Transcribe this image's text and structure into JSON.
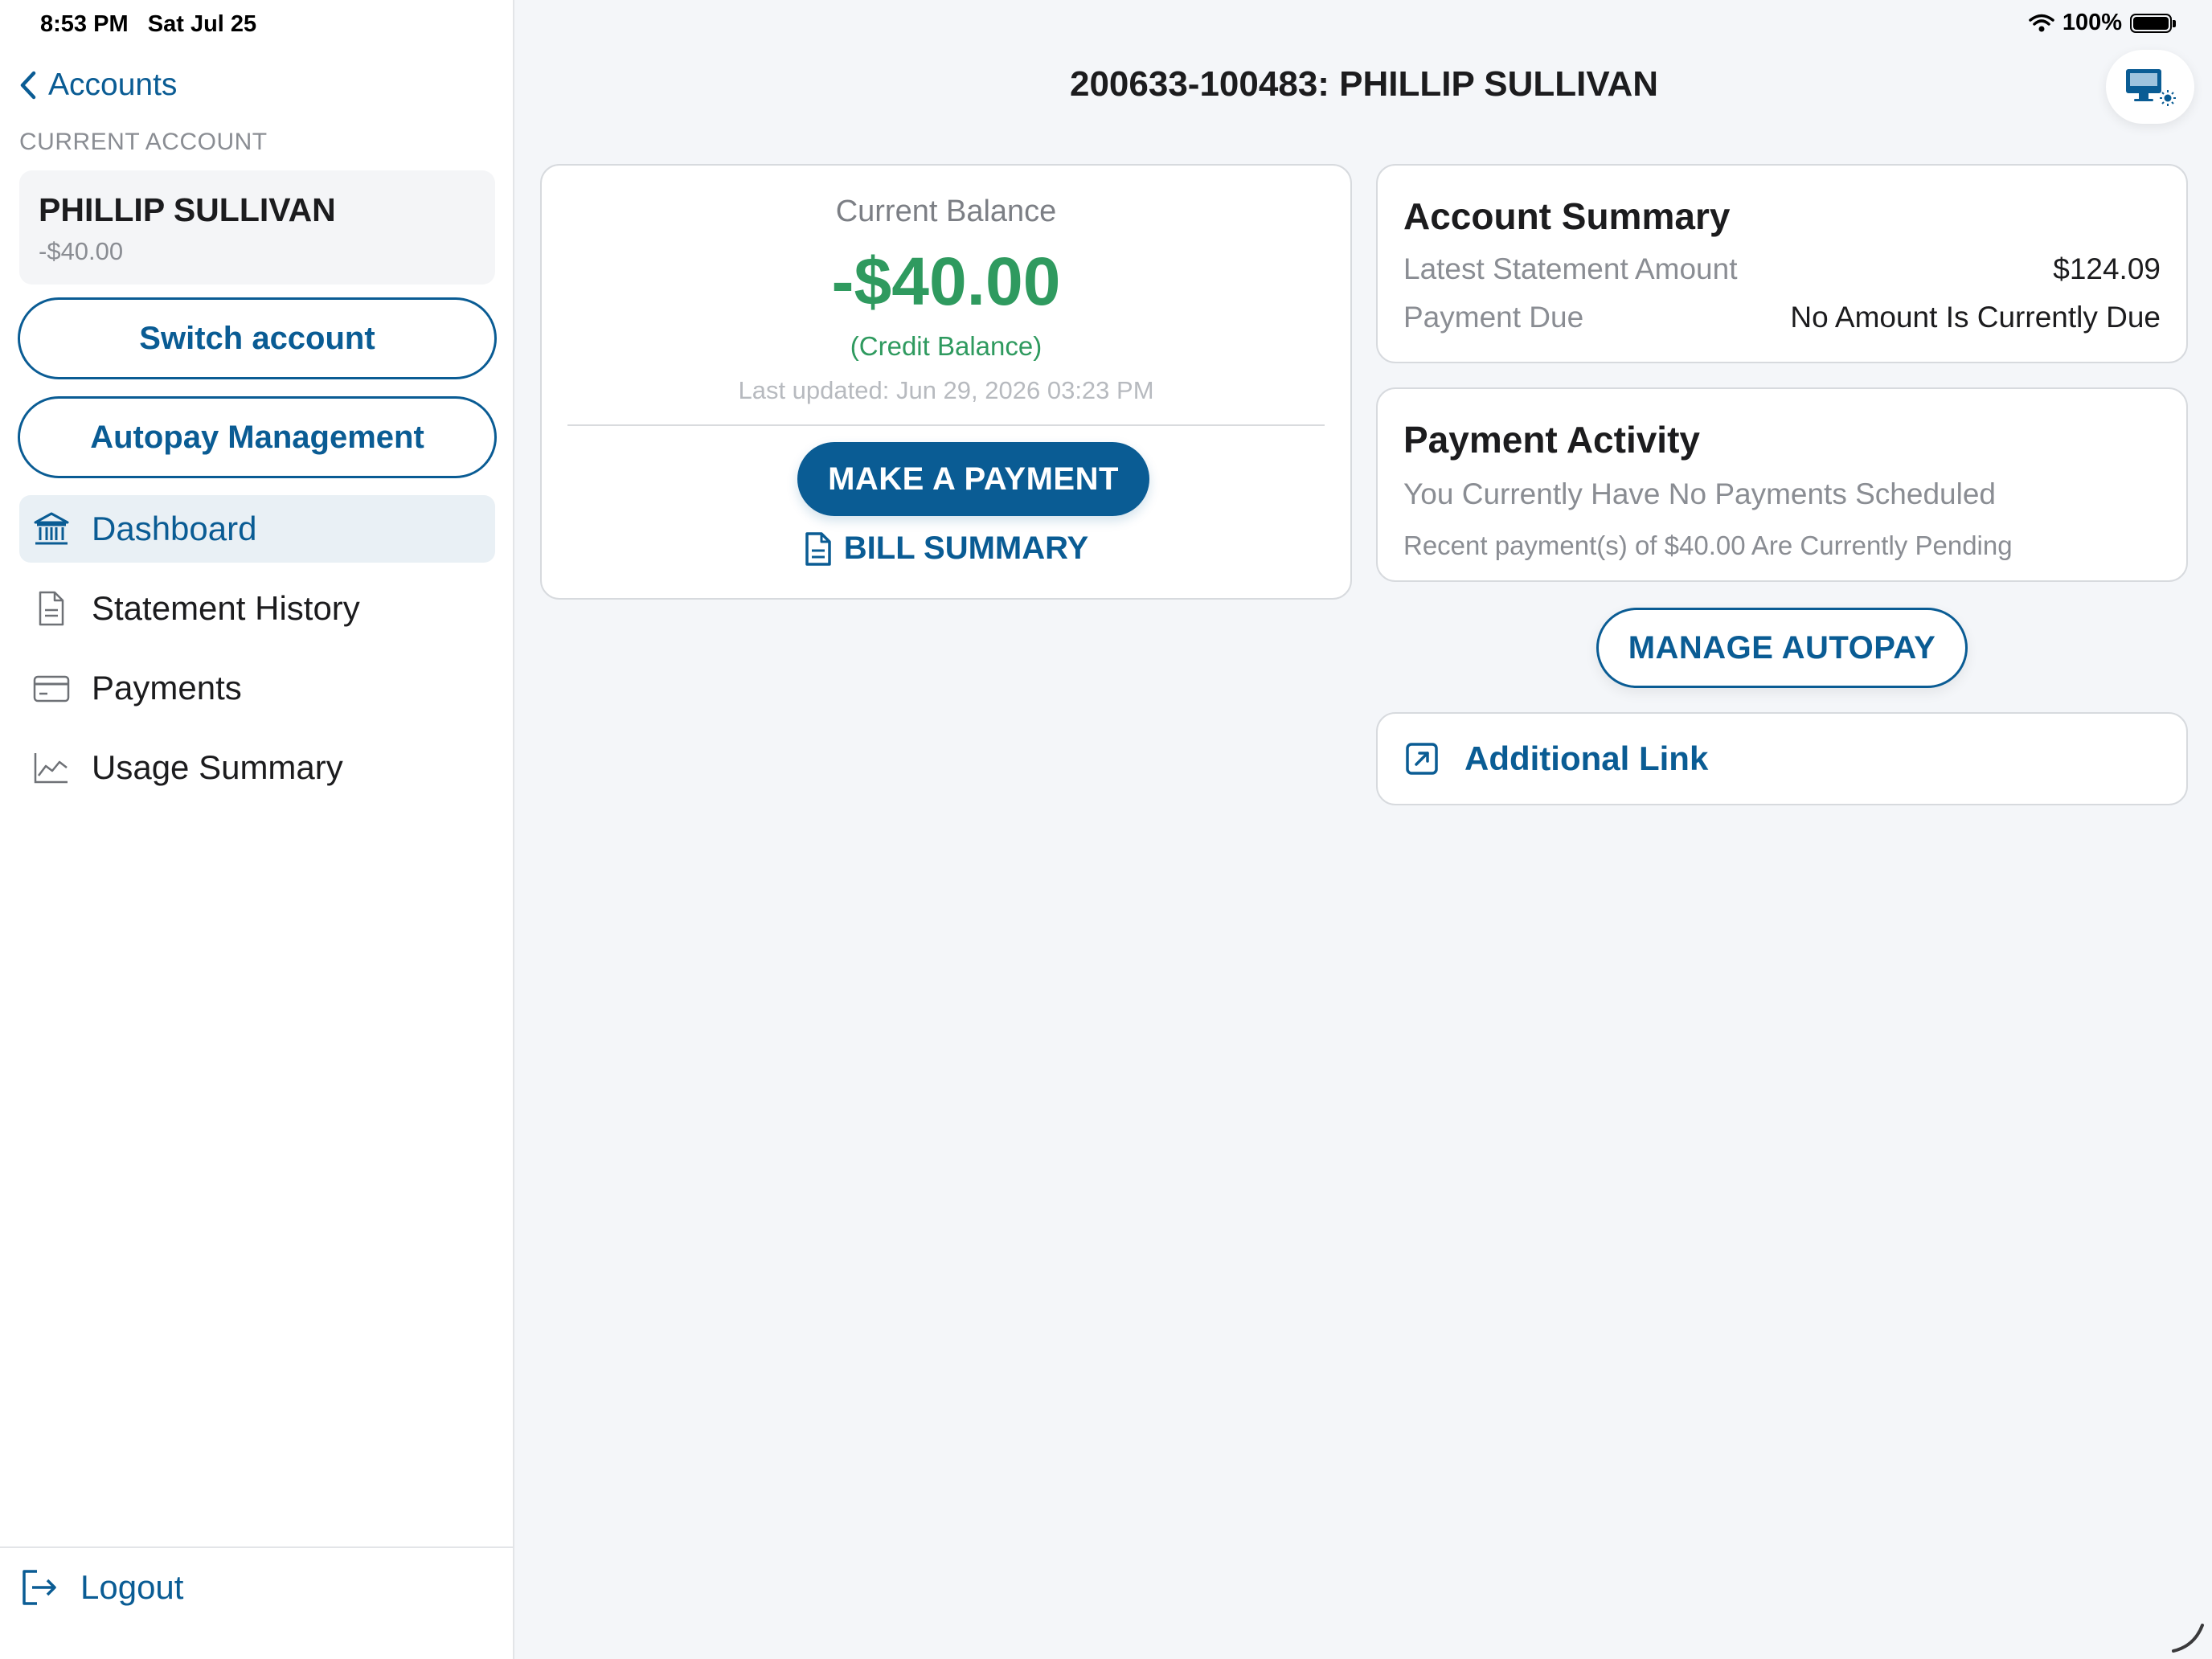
{
  "status_bar": {
    "time": "8:53 PM",
    "date": "Sat Jul 25",
    "battery": "100%"
  },
  "sidebar": {
    "back_label": "Accounts",
    "section_label": "CURRENT ACCOUNT",
    "account": {
      "name": "PHILLIP SULLIVAN",
      "balance": "-$40.00"
    },
    "switch_account": "Switch account",
    "autopay_management": "Autopay Management",
    "nav": [
      {
        "label": "Dashboard",
        "icon": "bank-icon",
        "active": true
      },
      {
        "label": "Statement History",
        "icon": "document-icon",
        "active": false
      },
      {
        "label": "Payments",
        "icon": "credit-card-icon",
        "active": false
      },
      {
        "label": "Usage Summary",
        "icon": "line-chart-icon",
        "active": false
      }
    ],
    "logout": "Logout"
  },
  "main": {
    "title": "200633-100483: PHILLIP SULLIVAN",
    "balance_card": {
      "label": "Current Balance",
      "amount": "-$40.00",
      "credit": "(Credit Balance)",
      "updated": "Last updated: Jun 29, 2026 03:23 PM",
      "pay_button": "MAKE A PAYMENT",
      "bill_summary": "BILL SUMMARY"
    },
    "account_summary": {
      "heading": "Account Summary",
      "rows": [
        {
          "key": "Latest Statement Amount",
          "value": "$124.09"
        },
        {
          "key": "Payment Due",
          "value": "No Amount Is Currently Due"
        }
      ]
    },
    "payment_activity": {
      "heading": "Payment Activity",
      "line1": "You Currently Have No Payments Scheduled",
      "line2": "Recent payment(s) of $40.00 Are Currently Pending"
    },
    "manage_autopay": "MANAGE AUTOPAY",
    "additional_link": "Additional Link"
  },
  "colors": {
    "accent": "#0a5c94",
    "credit_green": "#2f9a5f",
    "background": "#f4f6f9"
  }
}
